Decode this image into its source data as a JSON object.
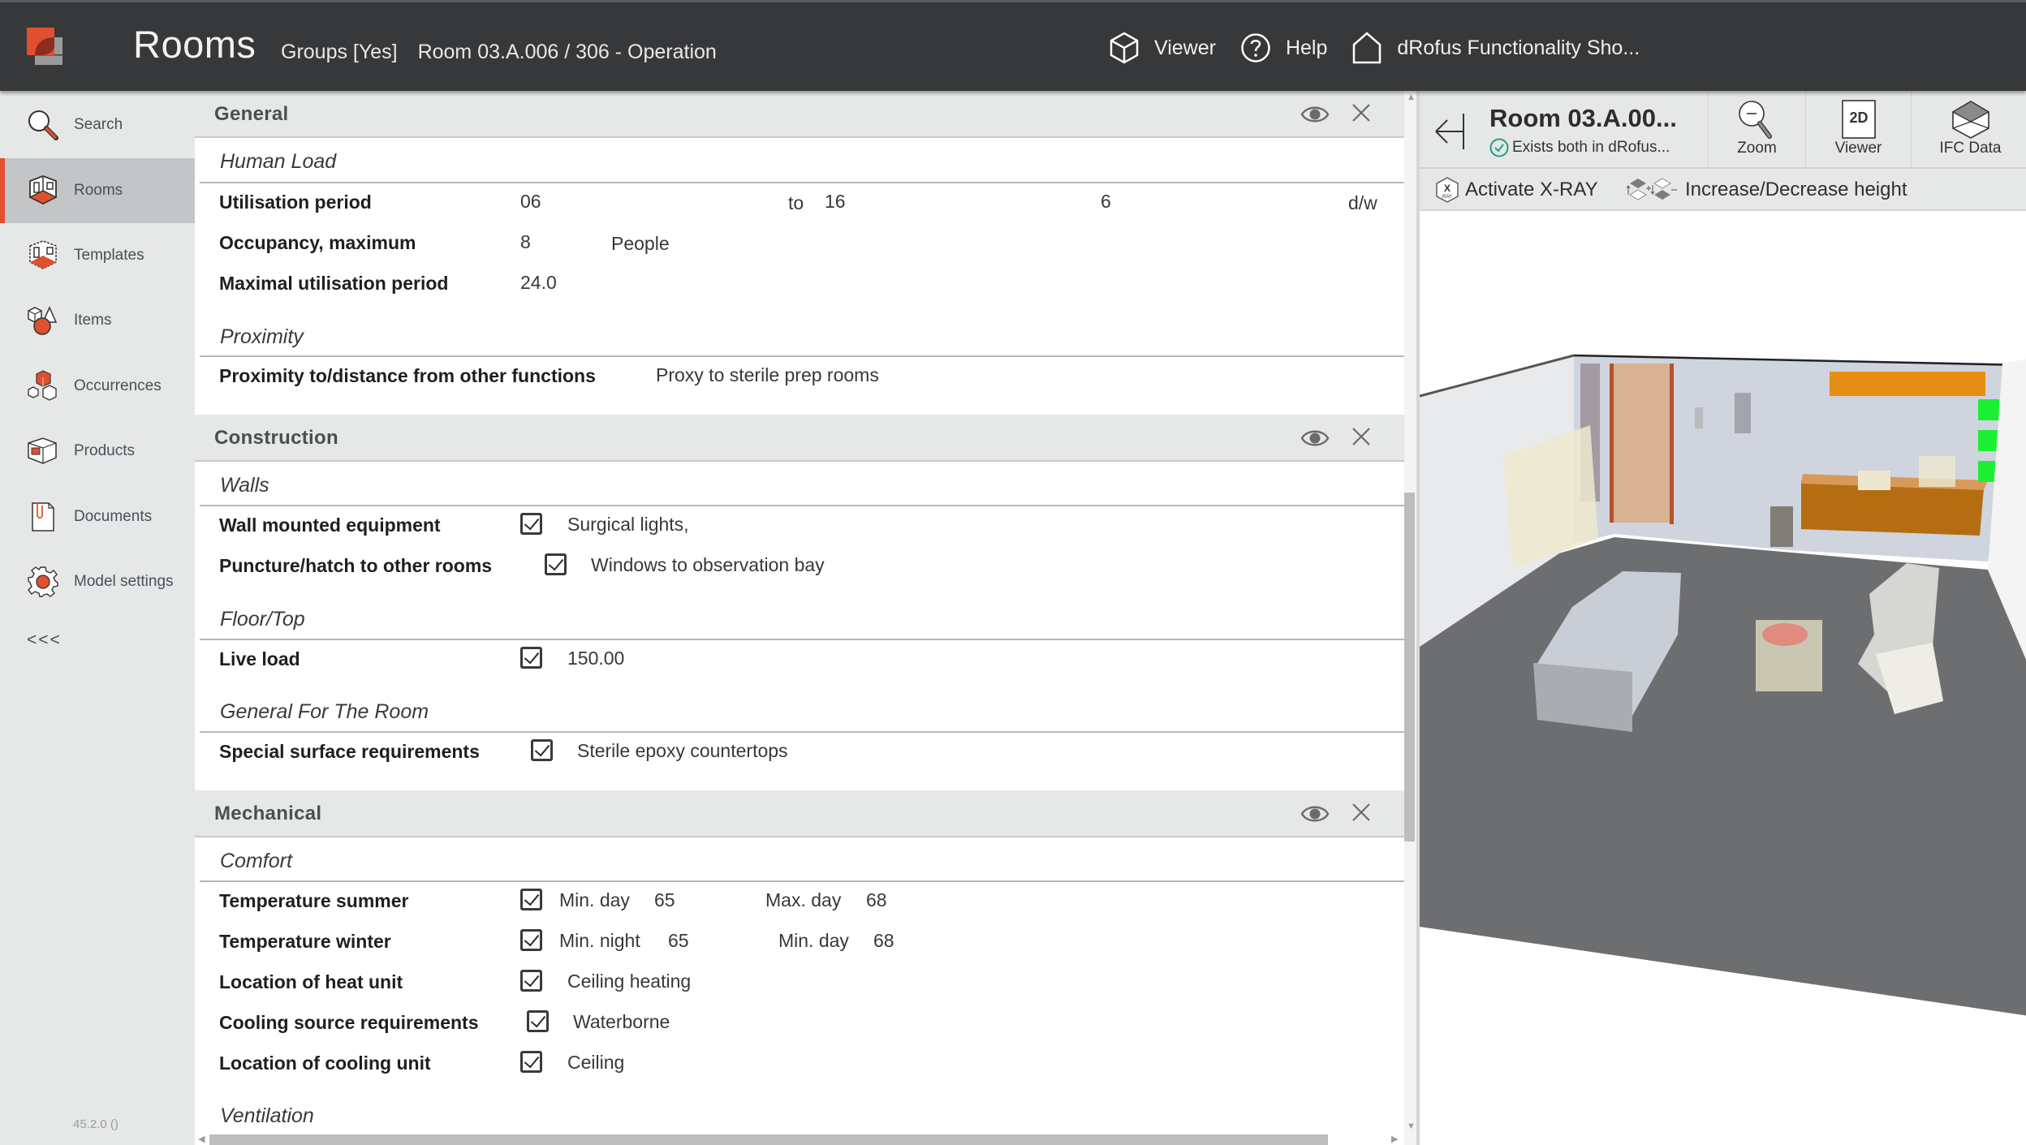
{
  "header": {
    "app_title": "Rooms",
    "breadcrumbs": [
      "Groups [Yes]",
      "Room 03.A.006 / 306 - Operation"
    ],
    "actions": [
      {
        "label": "Viewer",
        "icon": "cube-icon"
      },
      {
        "label": "Help",
        "icon": "help-circle-icon"
      },
      {
        "label": "dRofus Functionality Sho...",
        "icon": "home-icon"
      }
    ]
  },
  "sidebar": {
    "items": [
      {
        "label": "Search",
        "icon": "search-icon",
        "active": false
      },
      {
        "label": "Rooms",
        "icon": "rooms-icon",
        "active": true
      },
      {
        "label": "Templates",
        "icon": "templates-icon",
        "active": false
      },
      {
        "label": "Items",
        "icon": "items-icon",
        "active": false
      },
      {
        "label": "Occurrences",
        "icon": "occurrences-icon",
        "active": false
      },
      {
        "label": "Products",
        "icon": "products-icon",
        "active": false
      },
      {
        "label": "Documents",
        "icon": "documents-icon",
        "active": false
      },
      {
        "label": "Model settings",
        "icon": "gear-icon",
        "active": false
      }
    ],
    "collapse_label": "<<<",
    "version": "45.2.0 ()"
  },
  "sections": {
    "general": {
      "title": "General",
      "human_load": {
        "title": "Human Load",
        "utilisation_period": {
          "label": "Utilisation period",
          "from": "06",
          "to_label": "to",
          "to": "16",
          "days": "6",
          "unit": "d/w"
        },
        "occupancy": {
          "label": "Occupancy, maximum",
          "value": "8",
          "unit": "People"
        },
        "maximal_utilisation": {
          "label": "Maximal utilisation period",
          "value": "24.0"
        }
      },
      "proximity": {
        "title": "Proximity",
        "distance": {
          "label": "Proximity to/distance from other functions",
          "value": "Proxy to sterile prep rooms"
        }
      }
    },
    "construction": {
      "title": "Construction",
      "walls": {
        "title": "Walls",
        "wall_mounted": {
          "label": "Wall mounted equipment",
          "checked": true,
          "value": "Surgical lights,"
        },
        "puncture": {
          "label": "Puncture/hatch to other rooms",
          "checked": true,
          "value": "Windows to observation bay"
        }
      },
      "floor": {
        "title": "Floor/Top",
        "live_load": {
          "label": "Live load",
          "checked": true,
          "value": "150.00"
        }
      },
      "general_room": {
        "title": "General For The Room",
        "special_surface": {
          "label": "Special surface requirements",
          "checked": true,
          "value": "Sterile epoxy countertops"
        }
      }
    },
    "mechanical": {
      "title": "Mechanical",
      "comfort": {
        "title": "Comfort",
        "temp_summer": {
          "label": "Temperature summer",
          "checked": true,
          "a_label": "Min. day",
          "a_value": "65",
          "b_label": "Max. day",
          "b_value": "68"
        },
        "temp_winter": {
          "label": "Temperature winter",
          "checked": true,
          "a_label": "Min. night",
          "a_value": "65",
          "b_label": "Min. day",
          "b_value": "68"
        },
        "heat_unit": {
          "label": "Location of heat unit",
          "checked": true,
          "value": "Ceiling heating"
        },
        "cooling_source": {
          "label": "Cooling source requirements",
          "checked": true,
          "value": "Waterborne"
        },
        "cooling_unit": {
          "label": "Location of cooling unit",
          "checked": true,
          "value": "Ceiling"
        }
      },
      "ventilation": {
        "title": "Ventilation"
      }
    }
  },
  "viewer": {
    "title": "Room 03.A.00...",
    "status": "Exists both in dRofus...",
    "tools": [
      {
        "label": "Zoom",
        "icon": "zoom-out-icon"
      },
      {
        "label": "Viewer",
        "icon": "2d-viewer-icon",
        "badge": "2D"
      },
      {
        "label": "IFC Data",
        "icon": "ifc-data-icon"
      }
    ],
    "toolbar": {
      "xray_label": "Activate X-RAY",
      "height_label": "Increase/Decrease height"
    }
  },
  "colors": {
    "accent": "#e0502e",
    "header_bg": "#37383a",
    "sidebar_bg": "#e6e7e7",
    "status_ok": "#1f9e8a"
  }
}
